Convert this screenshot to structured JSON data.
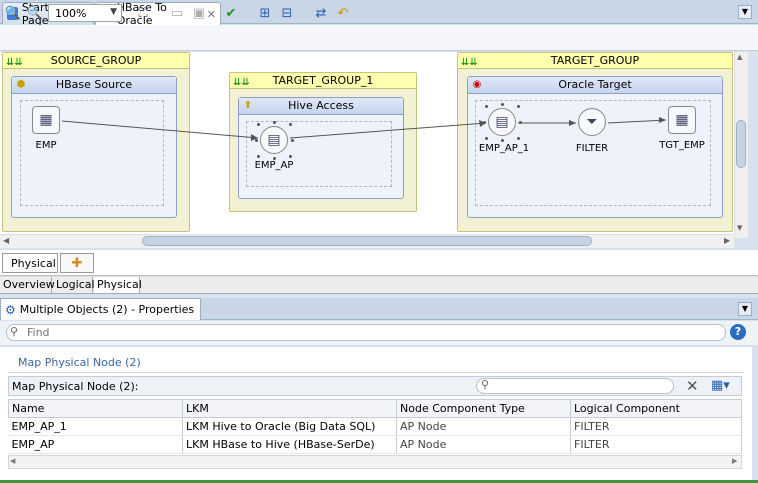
{
  "editor_tabs": [
    {
      "label": "Start Page"
    },
    {
      "label": "HBase To Oracle"
    }
  ],
  "toolbar": {
    "zoom_value": "100%"
  },
  "diagram": {
    "source_group": {
      "title": "SOURCE_GROUP",
      "exec_unit": "HBase Source",
      "node": "EMP"
    },
    "target_group_1": {
      "title": "TARGET_GROUP_1",
      "exec_unit": "Hive Access",
      "node": "EMP_AP"
    },
    "target_group": {
      "title": "TARGET_GROUP",
      "exec_unit": "Oracle Target",
      "nodes": [
        "EMP_AP_1",
        "FILTER",
        "TGT_EMP"
      ]
    }
  },
  "diagram_tabs": {
    "physical": "Physical"
  },
  "view_tabs": [
    "Overview",
    "Logical",
    "Physical"
  ],
  "properties": {
    "tab_title": "Multiple Objects (2) - Properties",
    "find_placeholder": "Find",
    "help": "?",
    "section_title": "Map Physical Node (2)",
    "table_title": "Map Physical Node (2):",
    "columns": [
      "Name",
      "LKM",
      "Node Component Type",
      "Logical Component"
    ],
    "rows": [
      [
        "EMP_AP_1",
        "LKM Hive to Oracle (Big Data SQL)",
        "AP Node",
        "FILTER"
      ],
      [
        "EMP_AP",
        "LKM HBase to Hive (HBase-SerDe)",
        "AP Node",
        "FILTER"
      ]
    ]
  }
}
